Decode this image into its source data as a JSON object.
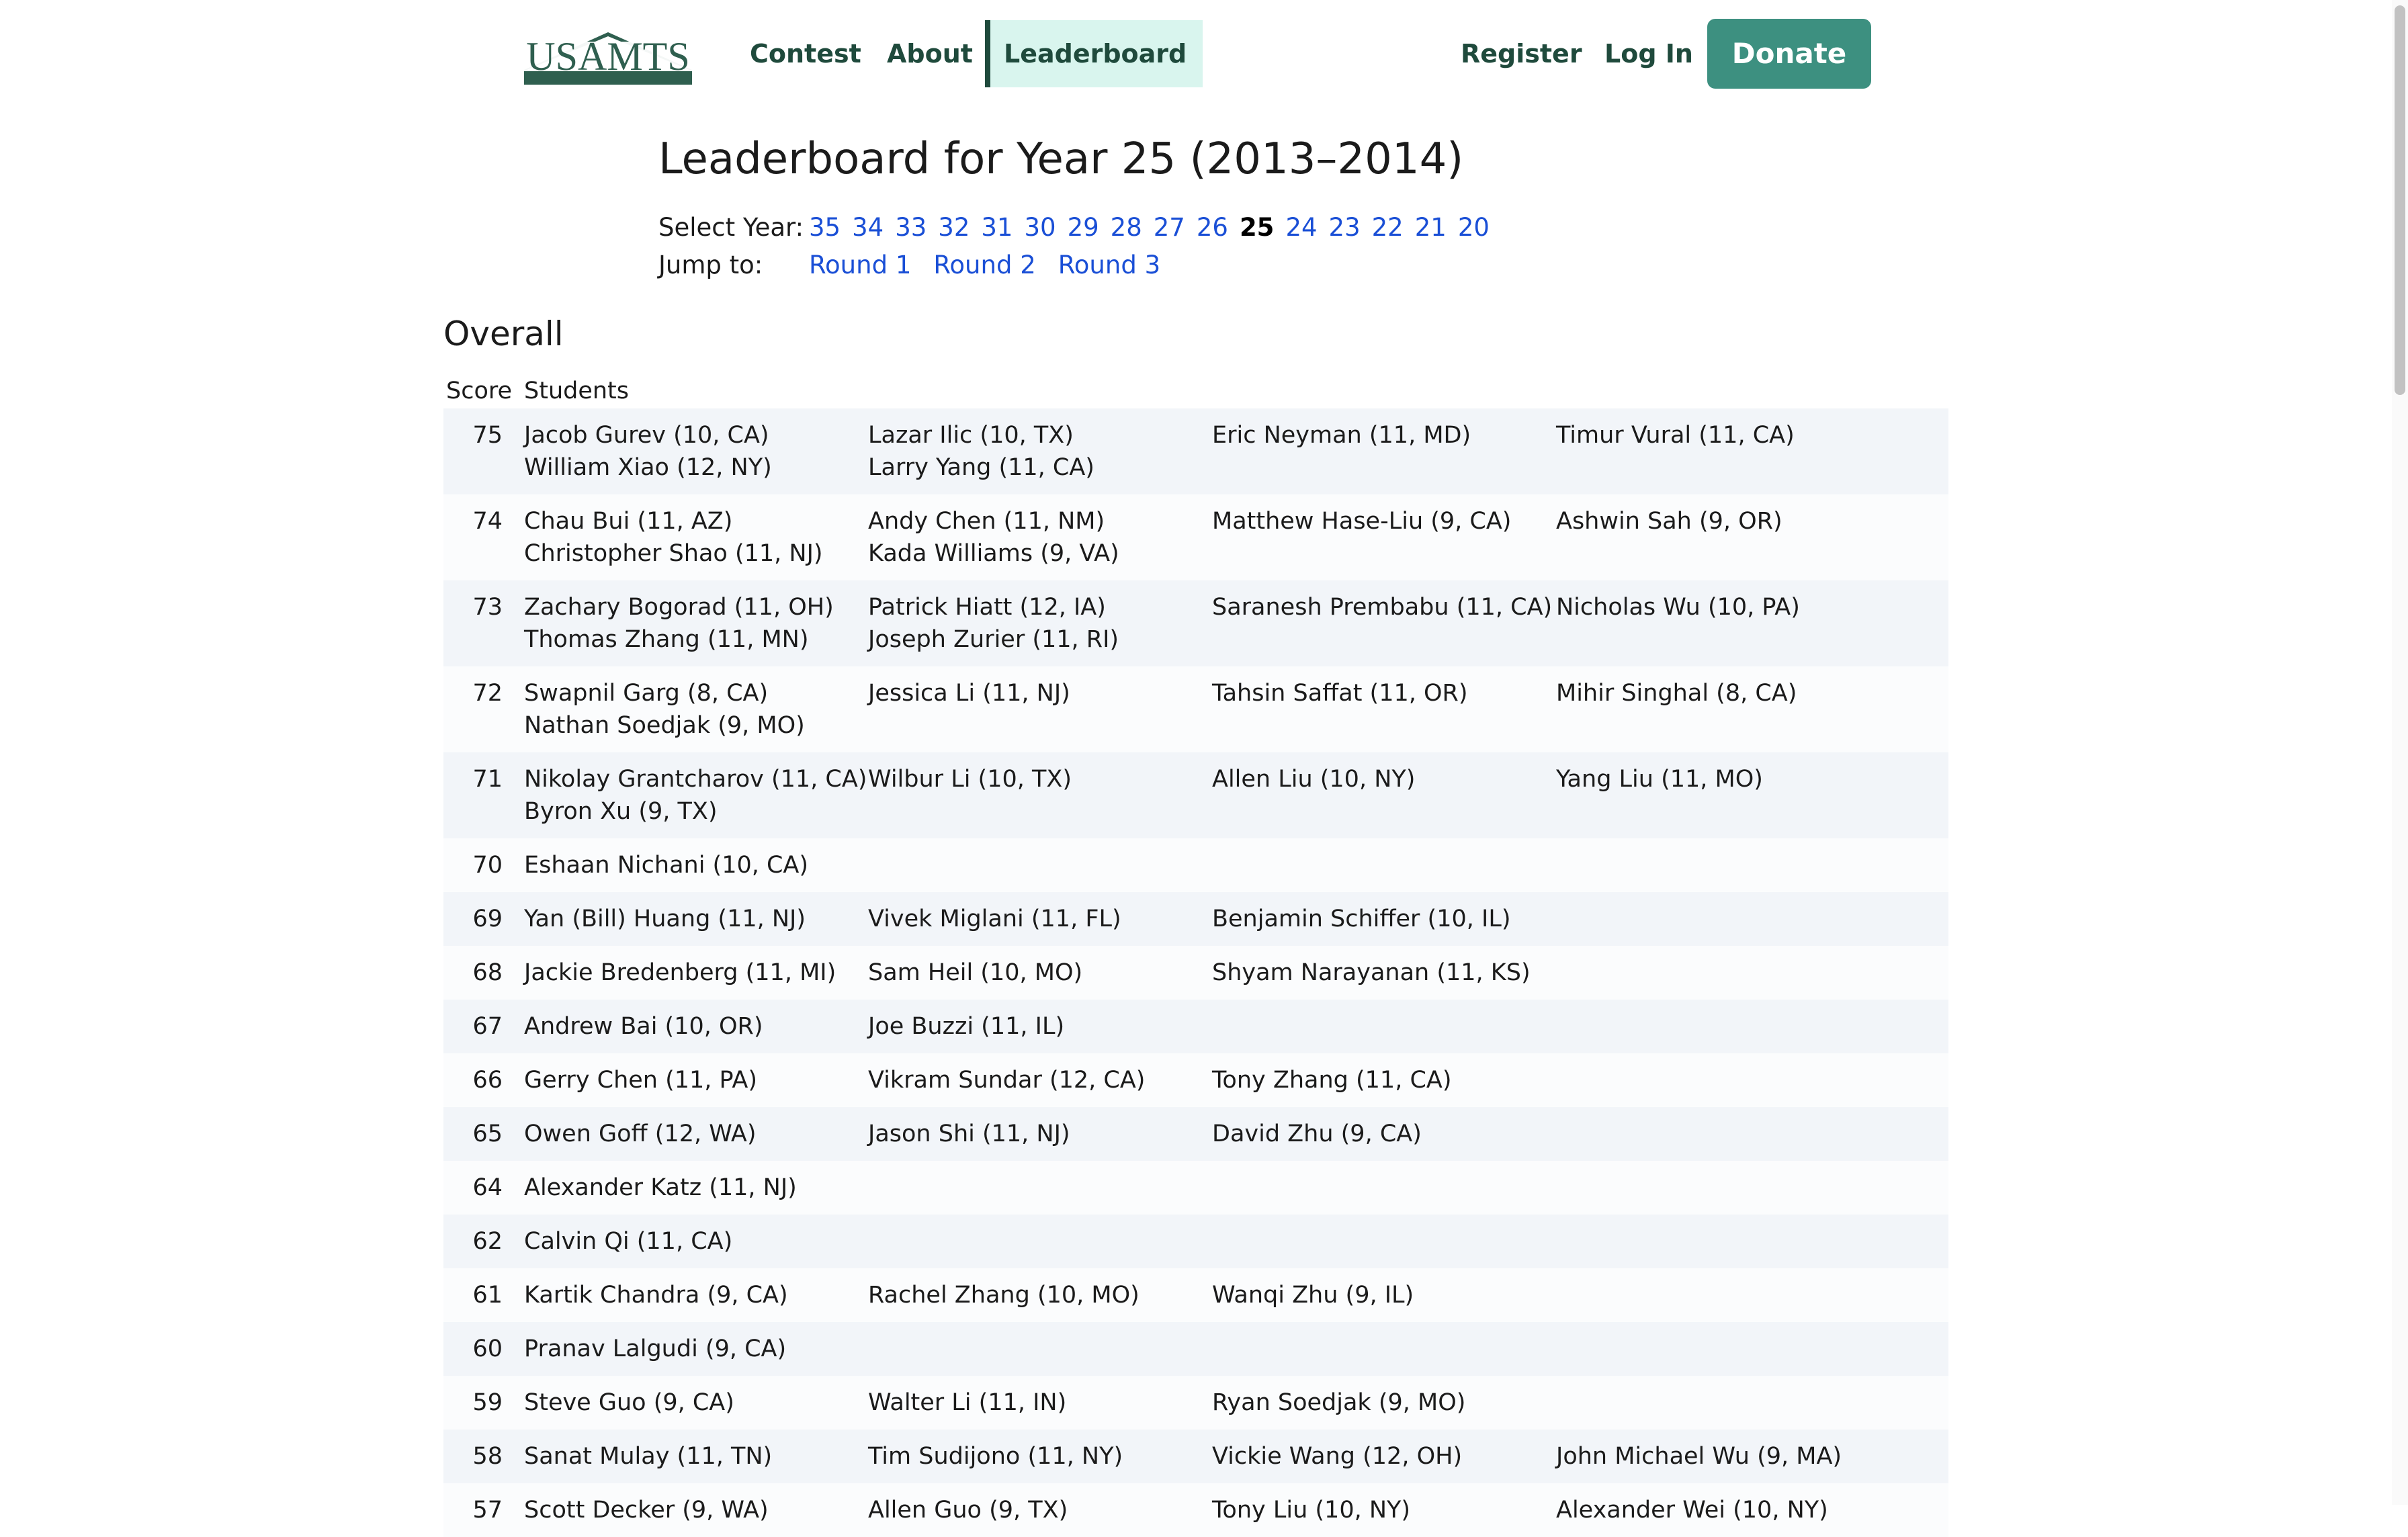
{
  "nav": {
    "logo_text": "USAMTS",
    "links": [
      "Contest",
      "About",
      "Leaderboard"
    ],
    "active": "Leaderboard",
    "register": "Register",
    "login": "Log In",
    "donate": "Donate"
  },
  "title": "Leaderboard for Year 25 (2013–2014)",
  "year_select": {
    "label": "Select Year:",
    "years": [
      "35",
      "34",
      "33",
      "32",
      "31",
      "30",
      "29",
      "28",
      "27",
      "26",
      "25",
      "24",
      "23",
      "22",
      "21",
      "20"
    ],
    "current": "25"
  },
  "jump": {
    "label": "Jump to:",
    "rounds": [
      "Round 1",
      "Round 2",
      "Round 3"
    ]
  },
  "overall": {
    "heading": "Overall",
    "columns": {
      "score": "Score",
      "students": "Students"
    },
    "rows": [
      {
        "score": "75",
        "cols": [
          [
            "Jacob Gurev (10, CA)",
            "William Xiao (12, NY)"
          ],
          [
            "Lazar Ilic (10, TX)",
            "Larry Yang (11, CA)"
          ],
          [
            "Eric Neyman (11, MD)"
          ],
          [
            "Timur Vural (11, CA)"
          ]
        ]
      },
      {
        "score": "74",
        "cols": [
          [
            "Chau Bui (11, AZ)",
            "Christopher Shao (11, NJ)"
          ],
          [
            "Andy Chen (11, NM)",
            "Kada Williams (9, VA)"
          ],
          [
            "Matthew Hase-Liu (9, CA)"
          ],
          [
            "Ashwin Sah (9, OR)"
          ]
        ]
      },
      {
        "score": "73",
        "cols": [
          [
            "Zachary Bogorad (11, OH)",
            "Thomas Zhang (11, MN)"
          ],
          [
            "Patrick Hiatt (12, IA)",
            "Joseph Zurier (11, RI)"
          ],
          [
            "Saranesh Prembabu (11, CA)"
          ],
          [
            "Nicholas Wu (10, PA)"
          ]
        ]
      },
      {
        "score": "72",
        "cols": [
          [
            "Swapnil Garg (8, CA)",
            "Nathan Soedjak (9, MO)"
          ],
          [
            "Jessica Li (11, NJ)"
          ],
          [
            "Tahsin Saffat (11, OR)"
          ],
          [
            "Mihir Singhal (8, CA)"
          ]
        ]
      },
      {
        "score": "71",
        "cols": [
          [
            "Nikolay Grantcharov (11, CA)",
            "Byron Xu (9, TX)"
          ],
          [
            "Wilbur Li (10, TX)"
          ],
          [
            "Allen Liu (10, NY)"
          ],
          [
            "Yang Liu (11, MO)"
          ]
        ]
      },
      {
        "score": "70",
        "cols": [
          [
            "Eshaan Nichani (10, CA)"
          ]
        ]
      },
      {
        "score": "69",
        "cols": [
          [
            "Yan (Bill) Huang (11, NJ)"
          ],
          [
            "Vivek Miglani (11, FL)"
          ],
          [
            "Benjamin Schiffer (10, IL)"
          ]
        ]
      },
      {
        "score": "68",
        "cols": [
          [
            "Jackie Bredenberg (11, MI)"
          ],
          [
            "Sam Heil (10, MO)"
          ],
          [
            "Shyam Narayanan (11, KS)"
          ]
        ]
      },
      {
        "score": "67",
        "cols": [
          [
            "Andrew Bai (10, OR)"
          ],
          [
            "Joe Buzzi (11, IL)"
          ]
        ]
      },
      {
        "score": "66",
        "cols": [
          [
            "Gerry Chen (11, PA)"
          ],
          [
            "Vikram Sundar (12, CA)"
          ],
          [
            "Tony Zhang (11, CA)"
          ]
        ]
      },
      {
        "score": "65",
        "cols": [
          [
            "Owen Goff (12, WA)"
          ],
          [
            "Jason Shi (11, NJ)"
          ],
          [
            "David Zhu (9, CA)"
          ]
        ]
      },
      {
        "score": "64",
        "cols": [
          [
            "Alexander Katz (11, NJ)"
          ]
        ]
      },
      {
        "score": "62",
        "cols": [
          [
            "Calvin Qi (11, CA)"
          ]
        ]
      },
      {
        "score": "61",
        "cols": [
          [
            "Kartik Chandra (9, CA)"
          ],
          [
            "Rachel Zhang (10, MO)"
          ],
          [
            "Wanqi Zhu (9, IL)"
          ]
        ]
      },
      {
        "score": "60",
        "cols": [
          [
            "Pranav Lalgudi (9, CA)"
          ]
        ]
      },
      {
        "score": "59",
        "cols": [
          [
            "Steve Guo (9, CA)"
          ],
          [
            "Walter Li (11, IN)"
          ],
          [
            "Ryan Soedjak (9, MO)"
          ]
        ]
      },
      {
        "score": "58",
        "cols": [
          [
            "Sanat Mulay (11, TN)"
          ],
          [
            "Tim Sudijono (11, NY)"
          ],
          [
            "Vickie Wang (12, OH)"
          ],
          [
            "John Michael Wu (9, MA)"
          ]
        ]
      },
      {
        "score": "57",
        "cols": [
          [
            "Scott Decker (9, WA)"
          ],
          [
            "Allen Guo (9, TX)"
          ],
          [
            "Tony Liu (10, NY)"
          ],
          [
            "Alexander Wei (10, NY)"
          ]
        ]
      }
    ]
  }
}
